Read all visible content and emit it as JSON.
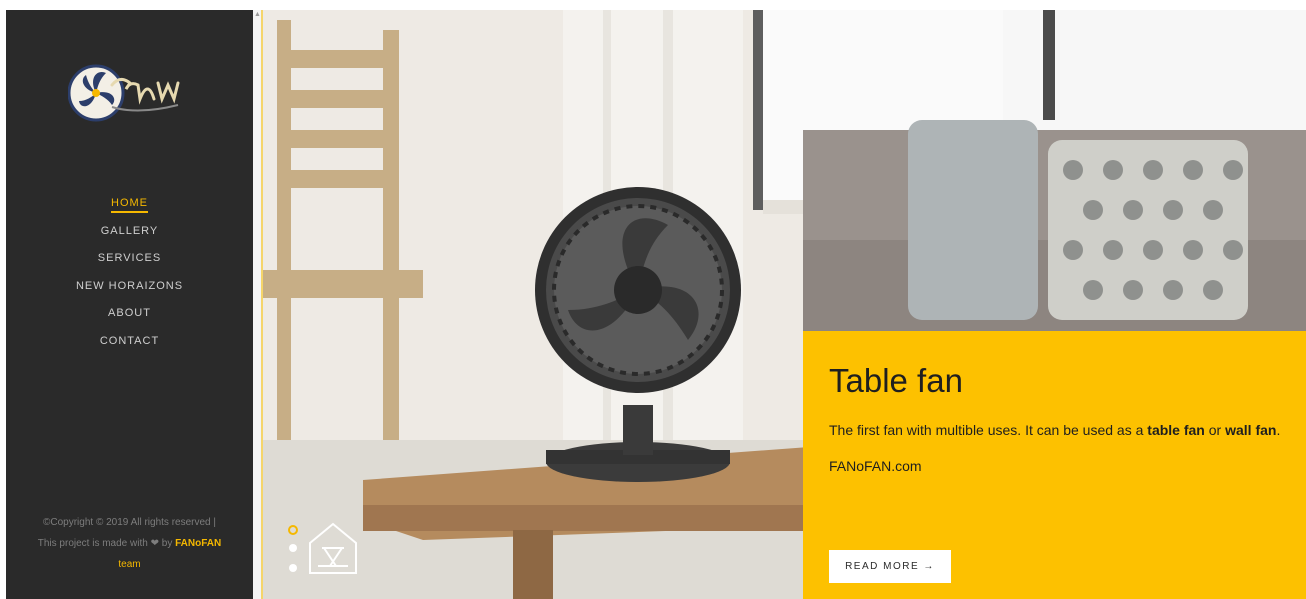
{
  "sidebar": {
    "nav": [
      {
        "label": "HOME",
        "active": true
      },
      {
        "label": "GALLERY",
        "active": false
      },
      {
        "label": "SERVICES",
        "active": false
      },
      {
        "label": "NEW HORAIZONS",
        "active": false
      },
      {
        "label": "ABOUT",
        "active": false
      },
      {
        "label": "CONTACT",
        "active": false
      }
    ],
    "footer": {
      "line1": "©Copyright © 2019 All rights reserved |",
      "line2_prefix": "This project is made with",
      "heart": "❤",
      "by": "by",
      "brand": "FANoFAN",
      "team": "team"
    }
  },
  "card": {
    "title": "Table fan",
    "desc_part1": "The first fan with multible uses. It can be used as a ",
    "desc_bold1": "table fan",
    "desc_part2": " or ",
    "desc_bold2": "wall fan",
    "desc_part3": ".",
    "site": "FANoFAN.com",
    "button": "READ MORE →"
  },
  "colors": {
    "accent": "#fdc100",
    "sidebar_bg": "#2a2a2a",
    "nav_text": "#cfcfcf",
    "active_nav": "#f5b800"
  }
}
